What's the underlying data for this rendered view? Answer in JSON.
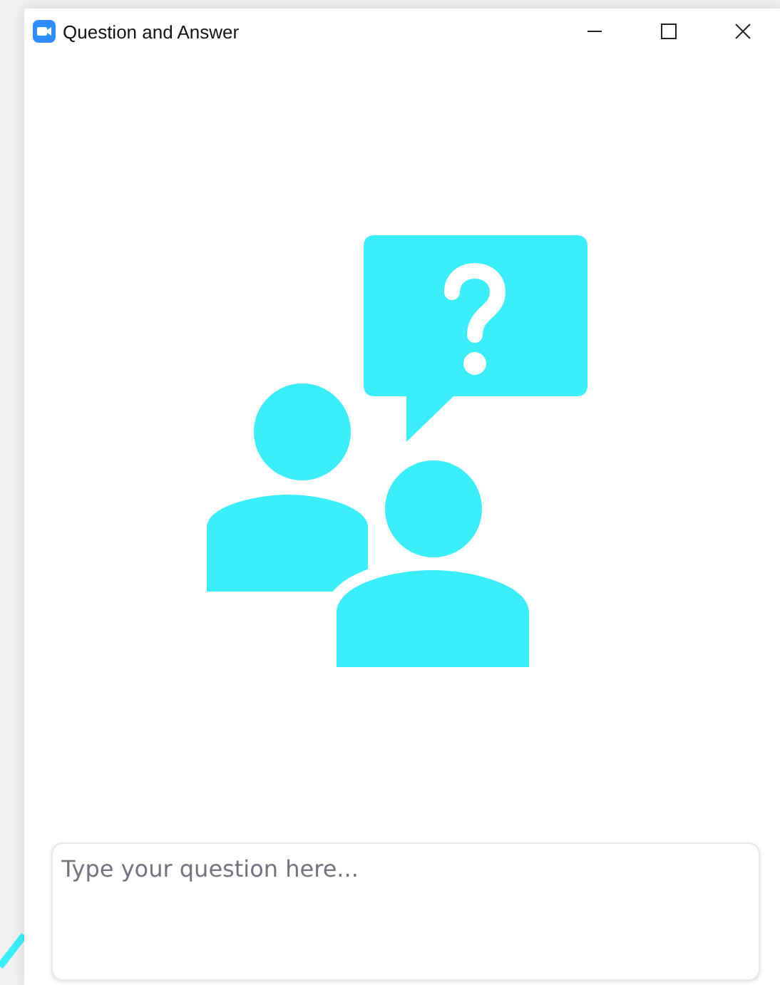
{
  "window": {
    "title": "Question and Answer"
  },
  "question_field": {
    "placeholder": "Type your question here..."
  }
}
